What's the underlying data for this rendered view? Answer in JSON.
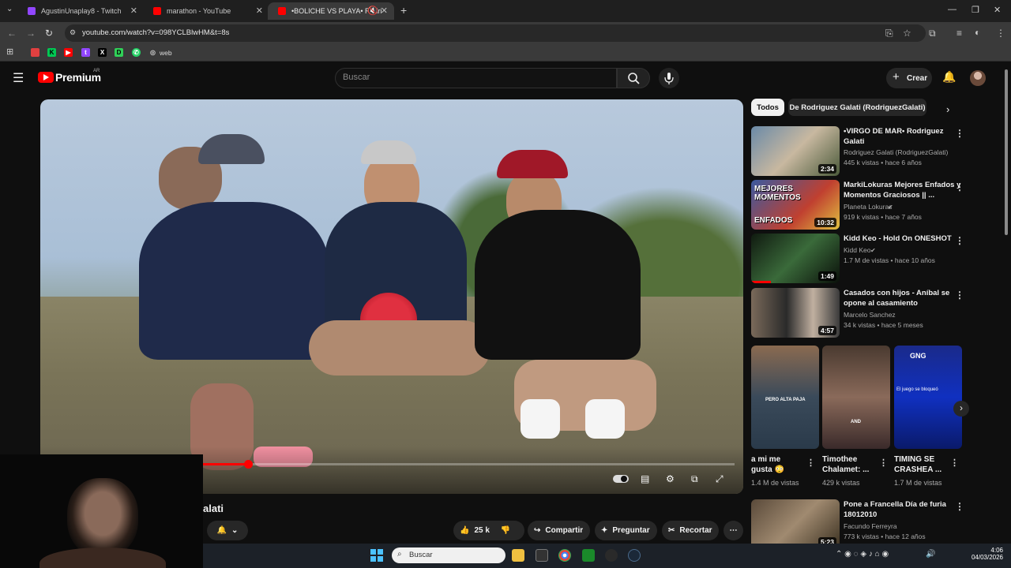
{
  "browser": {
    "tabs": [
      {
        "label": "AgustinUnaplay8 - Twitch",
        "color": "#9146ff"
      },
      {
        "label": "marathon - YouTube",
        "color": "#ff0000"
      },
      {
        "label": "•BOLICHE VS PLAYA• Rodri",
        "color": "#ff0000"
      }
    ],
    "url": "youtube.com/watch?v=098YCLBlwHM&t=8s",
    "bookmark_web": "web"
  },
  "youtube": {
    "brand": "Premium",
    "region": "AR",
    "search_placeholder": "Buscar",
    "create_label": "Crear"
  },
  "video": {
    "title_fragment": "alati",
    "progress_fraction": 0.29,
    "actions": {
      "likes": "25 k",
      "share": "Compartir",
      "ask": "Preguntar",
      "clip": "Recortar"
    }
  },
  "sidebar": {
    "chips": [
      "Todos",
      "De Rodriguez Galati (RodriguezGalati)"
    ],
    "videos": [
      {
        "title": "•VIRGO DE MAR• Rodriguez Galati",
        "channel": "Rodriguez Galati (RodriguezGalati)",
        "meta": "445 k vistas • hace 6 años",
        "duration": "2:34"
      },
      {
        "title": "MarkiLokuras Mejores Enfados y Momentos Graciosos || ...",
        "channel": "Planeta Lokuras",
        "meta": "919 k vistas • hace 7 años",
        "duration": "10:32"
      },
      {
        "title": "Kidd Keo - Hold On ONESHOT",
        "channel": "Kidd Keo",
        "meta": "1.7 M de vistas • hace 10 años",
        "duration": "1:49"
      },
      {
        "title": "Casados con hijos - Aníbal se opone al casamiento",
        "channel": "Marcelo Sanchez",
        "meta": "34 k vistas • hace 5 meses",
        "duration": "4:57"
      },
      {
        "title": "Pone a Francella   Día de furia 18012010",
        "channel": "Facundo Ferreyra",
        "meta": "773 k vistas • hace 12 años",
        "duration": "5:23"
      }
    ],
    "shorts": [
      {
        "title": "a mi me gusta 😳",
        "views": "1.4 M de vistas",
        "caption": "PERO ALTA PAJA"
      },
      {
        "title": "Timothee Chalamet: ...",
        "views": "429 k vistas",
        "caption": "AND"
      },
      {
        "title": "TIMING SE CRASHEA ...",
        "views": "1.7 M de vistas",
        "caption": "El juego se bloqueó"
      }
    ]
  },
  "taskbar": {
    "search": "Buscar",
    "time": "4:06",
    "date": "04/03/2026"
  }
}
